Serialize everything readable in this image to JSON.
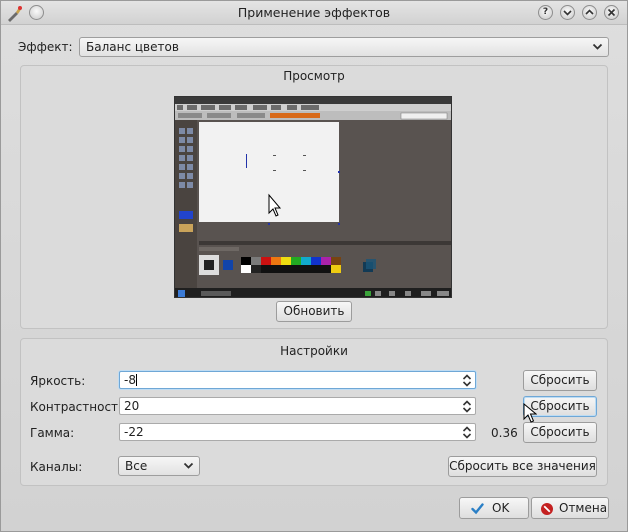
{
  "window": {
    "title": "Применение эффектов",
    "buttons": [
      "help-icon",
      "minimize-icon",
      "maximize-icon",
      "close-icon"
    ]
  },
  "effect": {
    "label": "Эффект:",
    "value": "Баланс цветов"
  },
  "preview": {
    "title": "Просмотр",
    "refresh_label": "Обновить"
  },
  "settings": {
    "title": "Настройки",
    "brightness": {
      "label": "Яркость:",
      "value": "-8",
      "reset_label": "Сбросить"
    },
    "contrast": {
      "label": "Контрастность:",
      "value": "20",
      "reset_label": "Сбросить"
    },
    "gamma": {
      "label": "Гамма:",
      "value": "-22",
      "readout": "0.36",
      "reset_label": "Сбросить"
    },
    "channels": {
      "label": "Каналы:",
      "value": "Все"
    },
    "reset_all_label": "Сбросить все значения"
  },
  "footer": {
    "ok_label": "OK",
    "cancel_label": "Отмена"
  },
  "colors": {
    "focus_border": "#6fa7d6",
    "ok_icon": "#2a7fc6",
    "cancel_icon": "#c42020"
  }
}
